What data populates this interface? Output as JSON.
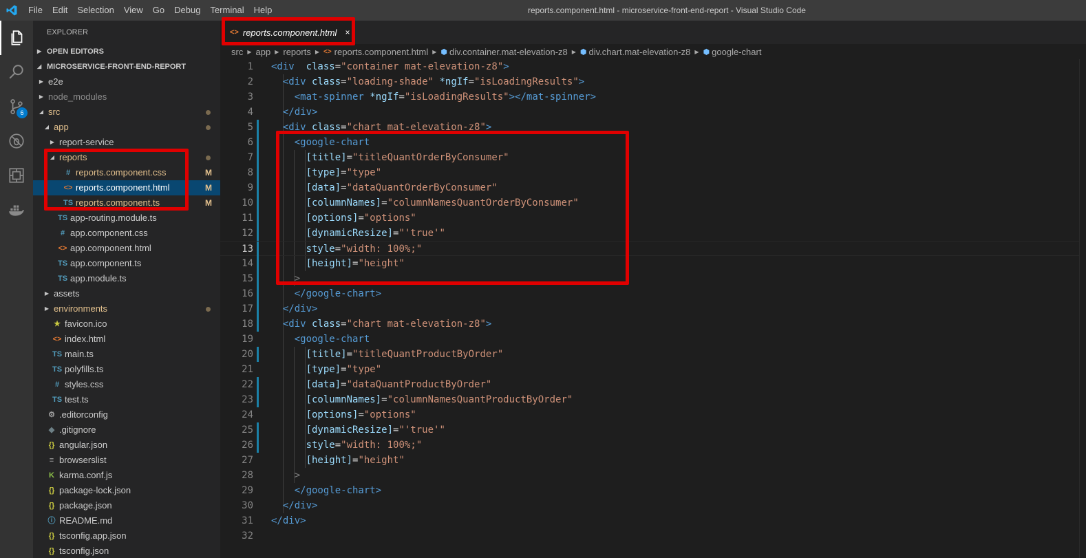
{
  "titlebar": {
    "menu": [
      "File",
      "Edit",
      "Selection",
      "View",
      "Go",
      "Debug",
      "Terminal",
      "Help"
    ],
    "window_title": "reports.component.html - microservice-front-end-report - Visual Studio Code"
  },
  "activitybar": {
    "items": [
      "files-icon",
      "search-icon",
      "source-control-icon",
      "debug-icon",
      "extensions-icon",
      "docker-icon"
    ],
    "scm_badge": "6",
    "accent": "#007acc"
  },
  "sidebar": {
    "title": "EXPLORER",
    "open_editors": "OPEN EDITORS",
    "project": "MICROSERVICE-FRONT-END-REPORT",
    "tree": [
      {
        "label": "e2e",
        "icon": "",
        "twisty": "closed",
        "indent": 1,
        "cls": ""
      },
      {
        "label": "node_modules",
        "icon": "",
        "twisty": "closed",
        "indent": 1,
        "cls": "dim"
      },
      {
        "label": "src",
        "icon": "",
        "twisty": "open",
        "indent": 1,
        "cls": "mod",
        "dot": true
      },
      {
        "label": "app",
        "icon": "",
        "twisty": "open",
        "indent": 2,
        "cls": "mod",
        "dot": true
      },
      {
        "label": "report-service",
        "icon": "",
        "twisty": "closed",
        "indent": 3,
        "cls": ""
      },
      {
        "label": "reports",
        "icon": "",
        "twisty": "open",
        "indent": 3,
        "cls": "mod",
        "dot": true
      },
      {
        "label": "reports.component.css",
        "icon": "#",
        "iconcls": "c-css",
        "indent": 4,
        "cls": "mod",
        "status": "M"
      },
      {
        "label": "reports.component.html",
        "icon": "<>",
        "iconcls": "c-html",
        "indent": 4,
        "cls": "mod",
        "status": "M",
        "selected": true
      },
      {
        "label": "reports.component.ts",
        "icon": "TS",
        "iconcls": "c-ts",
        "indent": 4,
        "cls": "mod",
        "status": "M"
      },
      {
        "label": "app-routing.module.ts",
        "icon": "TS",
        "iconcls": "c-ts",
        "indent": 3,
        "cls": ""
      },
      {
        "label": "app.component.css",
        "icon": "#",
        "iconcls": "c-css",
        "indent": 3,
        "cls": ""
      },
      {
        "label": "app.component.html",
        "icon": "<>",
        "iconcls": "c-html",
        "indent": 3,
        "cls": ""
      },
      {
        "label": "app.component.ts",
        "icon": "TS",
        "iconcls": "c-ts",
        "indent": 3,
        "cls": ""
      },
      {
        "label": "app.module.ts",
        "icon": "TS",
        "iconcls": "c-ts",
        "indent": 3,
        "cls": ""
      },
      {
        "label": "assets",
        "icon": "",
        "twisty": "closed",
        "indent": 2,
        "cls": ""
      },
      {
        "label": "environments",
        "icon": "",
        "twisty": "closed",
        "indent": 2,
        "cls": "mod",
        "dot": true
      },
      {
        "label": "favicon.ico",
        "icon": "★",
        "iconcls": "c-star",
        "indent": 2,
        "cls": ""
      },
      {
        "label": "index.html",
        "icon": "<>",
        "iconcls": "c-html",
        "indent": 2,
        "cls": ""
      },
      {
        "label": "main.ts",
        "icon": "TS",
        "iconcls": "c-ts",
        "indent": 2,
        "cls": ""
      },
      {
        "label": "polyfills.ts",
        "icon": "TS",
        "iconcls": "c-ts",
        "indent": 2,
        "cls": ""
      },
      {
        "label": "styles.css",
        "icon": "#",
        "iconcls": "c-css",
        "indent": 2,
        "cls": ""
      },
      {
        "label": "test.ts",
        "icon": "TS",
        "iconcls": "c-ts",
        "indent": 2,
        "cls": ""
      },
      {
        "label": ".editorconfig",
        "icon": "⚙",
        "iconcls": "c-gear",
        "indent": 1,
        "cls": ""
      },
      {
        "label": ".gitignore",
        "icon": "◆",
        "iconcls": "c-git",
        "indent": 1,
        "cls": ""
      },
      {
        "label": "angular.json",
        "icon": "{}",
        "iconcls": "c-json",
        "indent": 1,
        "cls": ""
      },
      {
        "label": "browserslist",
        "icon": "≡",
        "iconcls": "c-gear",
        "indent": 1,
        "cls": ""
      },
      {
        "label": "karma.conf.js",
        "icon": "K",
        "iconcls": "c-k",
        "indent": 1,
        "cls": ""
      },
      {
        "label": "package-lock.json",
        "icon": "{}",
        "iconcls": "c-json",
        "indent": 1,
        "cls": ""
      },
      {
        "label": "package.json",
        "icon": "{}",
        "iconcls": "c-json",
        "indent": 1,
        "cls": ""
      },
      {
        "label": "README.md",
        "icon": "ⓘ",
        "iconcls": "c-info",
        "indent": 1,
        "cls": ""
      },
      {
        "label": "tsconfig.app.json",
        "icon": "{}",
        "iconcls": "c-json",
        "indent": 1,
        "cls": ""
      },
      {
        "label": "tsconfig.json",
        "icon": "{}",
        "iconcls": "c-json",
        "indent": 1,
        "cls": ""
      }
    ]
  },
  "tab": {
    "icon": "<>",
    "label": "reports.component.html",
    "close": "×"
  },
  "breadcrumb": [
    "src",
    "app",
    "reports",
    "reports.component.html",
    "div.container.mat-elevation-z8",
    "div.chart.mat-elevation-z8",
    "google-chart"
  ],
  "editor": {
    "current_line": 13,
    "modified_lines": [
      5,
      6,
      7,
      8,
      9,
      10,
      11,
      12,
      13,
      14,
      15,
      16,
      17,
      18,
      20,
      22,
      23,
      25,
      26
    ],
    "lines": [
      [
        [
          "tg",
          "<div"
        ],
        [
          "",
          "  "
        ],
        [
          "at",
          "class"
        ],
        [
          "",
          "="
        ],
        [
          "st",
          "\"container mat-elevation-z8\""
        ],
        [
          "tg",
          ">"
        ]
      ],
      [
        [
          "",
          "  "
        ],
        [
          "tg",
          "<div"
        ],
        [
          "",
          ""
        ],
        [
          "at",
          " class"
        ],
        [
          "",
          "="
        ],
        [
          "st",
          "\"loading-shade\""
        ],
        [
          "at",
          " *ngIf"
        ],
        [
          "",
          "="
        ],
        [
          "st",
          "\"isLoadingResults\""
        ],
        [
          "tg",
          ">"
        ]
      ],
      [
        [
          "",
          "    "
        ],
        [
          "tg",
          "<mat-spinner"
        ],
        [
          "at",
          " *ngIf"
        ],
        [
          "",
          "="
        ],
        [
          "st",
          "\"isLoadingResults\""
        ],
        [
          "tg",
          "></mat-spinner>"
        ]
      ],
      [
        [
          "",
          "  "
        ],
        [
          "tg",
          "</div>"
        ]
      ],
      [
        [
          "",
          "  "
        ],
        [
          "tg",
          "<div"
        ],
        [
          "at",
          " class"
        ],
        [
          "",
          "="
        ],
        [
          "st",
          "\"chart mat-elevation-z8\""
        ],
        [
          "tg",
          ">"
        ]
      ],
      [
        [
          "",
          "    "
        ],
        [
          "tg",
          "<google-chart"
        ]
      ],
      [
        [
          "",
          "      "
        ],
        [
          "at",
          "[title]"
        ],
        [
          "",
          "="
        ],
        [
          "st",
          "\"titleQuantOrderByConsumer\""
        ]
      ],
      [
        [
          "",
          "      "
        ],
        [
          "at",
          "[type]"
        ],
        [
          "",
          "="
        ],
        [
          "st",
          "\"type\""
        ]
      ],
      [
        [
          "",
          "      "
        ],
        [
          "at",
          "[data]"
        ],
        [
          "",
          "="
        ],
        [
          "st",
          "\"dataQuantOrderByConsumer\""
        ]
      ],
      [
        [
          "",
          "      "
        ],
        [
          "at",
          "[columnNames]"
        ],
        [
          "",
          "="
        ],
        [
          "st",
          "\"columnNamesQuantOrderByConsumer\""
        ]
      ],
      [
        [
          "",
          "      "
        ],
        [
          "at",
          "[options]"
        ],
        [
          "",
          "="
        ],
        [
          "st",
          "\"options\""
        ]
      ],
      [
        [
          "",
          "      "
        ],
        [
          "at",
          "[dynamicResize]"
        ],
        [
          "",
          "="
        ],
        [
          "st",
          "\"'true'\""
        ]
      ],
      [
        [
          "",
          "      "
        ],
        [
          "at",
          "style"
        ],
        [
          "",
          "="
        ],
        [
          "st",
          "\"width: 100%;\""
        ]
      ],
      [
        [
          "",
          "      "
        ],
        [
          "at",
          "[height]"
        ],
        [
          "",
          "="
        ],
        [
          "st",
          "\"height\""
        ]
      ],
      [
        [
          "",
          "    "
        ],
        [
          "pu",
          ">"
        ]
      ],
      [
        [
          "",
          "    "
        ],
        [
          "tg",
          "</google-chart>"
        ]
      ],
      [
        [
          "",
          "  "
        ],
        [
          "tg",
          "</div>"
        ]
      ],
      [
        [
          "",
          "  "
        ],
        [
          "tg",
          "<div"
        ],
        [
          "at",
          " class"
        ],
        [
          "",
          "="
        ],
        [
          "st",
          "\"chart mat-elevation-z8\""
        ],
        [
          "tg",
          ">"
        ]
      ],
      [
        [
          "",
          "    "
        ],
        [
          "tg",
          "<google-chart"
        ]
      ],
      [
        [
          "",
          "      "
        ],
        [
          "at",
          "[title]"
        ],
        [
          "",
          "="
        ],
        [
          "st",
          "\"titleQuantProductByOrder\""
        ]
      ],
      [
        [
          "",
          "      "
        ],
        [
          "at",
          "[type]"
        ],
        [
          "",
          "="
        ],
        [
          "st",
          "\"type\""
        ]
      ],
      [
        [
          "",
          "      "
        ],
        [
          "at",
          "[data]"
        ],
        [
          "",
          "="
        ],
        [
          "st",
          "\"dataQuantProductByOrder\""
        ]
      ],
      [
        [
          "",
          "      "
        ],
        [
          "at",
          "[columnNames]"
        ],
        [
          "",
          "="
        ],
        [
          "st",
          "\"columnNamesQuantProductByOrder\""
        ]
      ],
      [
        [
          "",
          "      "
        ],
        [
          "at",
          "[options]"
        ],
        [
          "",
          "="
        ],
        [
          "st",
          "\"options\""
        ]
      ],
      [
        [
          "",
          "      "
        ],
        [
          "at",
          "[dynamicResize]"
        ],
        [
          "",
          "="
        ],
        [
          "st",
          "\"'true'\""
        ]
      ],
      [
        [
          "",
          "      "
        ],
        [
          "at",
          "style"
        ],
        [
          "",
          "="
        ],
        [
          "st",
          "\"width: 100%;\""
        ]
      ],
      [
        [
          "",
          "      "
        ],
        [
          "at",
          "[height]"
        ],
        [
          "",
          "="
        ],
        [
          "st",
          "\"height\""
        ]
      ],
      [
        [
          "",
          "    "
        ],
        [
          "pu",
          ">"
        ]
      ],
      [
        [
          "",
          "    "
        ],
        [
          "tg",
          "</google-chart>"
        ]
      ],
      [
        [
          "",
          "  "
        ],
        [
          "tg",
          "</div>"
        ]
      ],
      [
        [
          "tg",
          "</div>"
        ]
      ],
      []
    ]
  },
  "highlight_color": "#e00000"
}
